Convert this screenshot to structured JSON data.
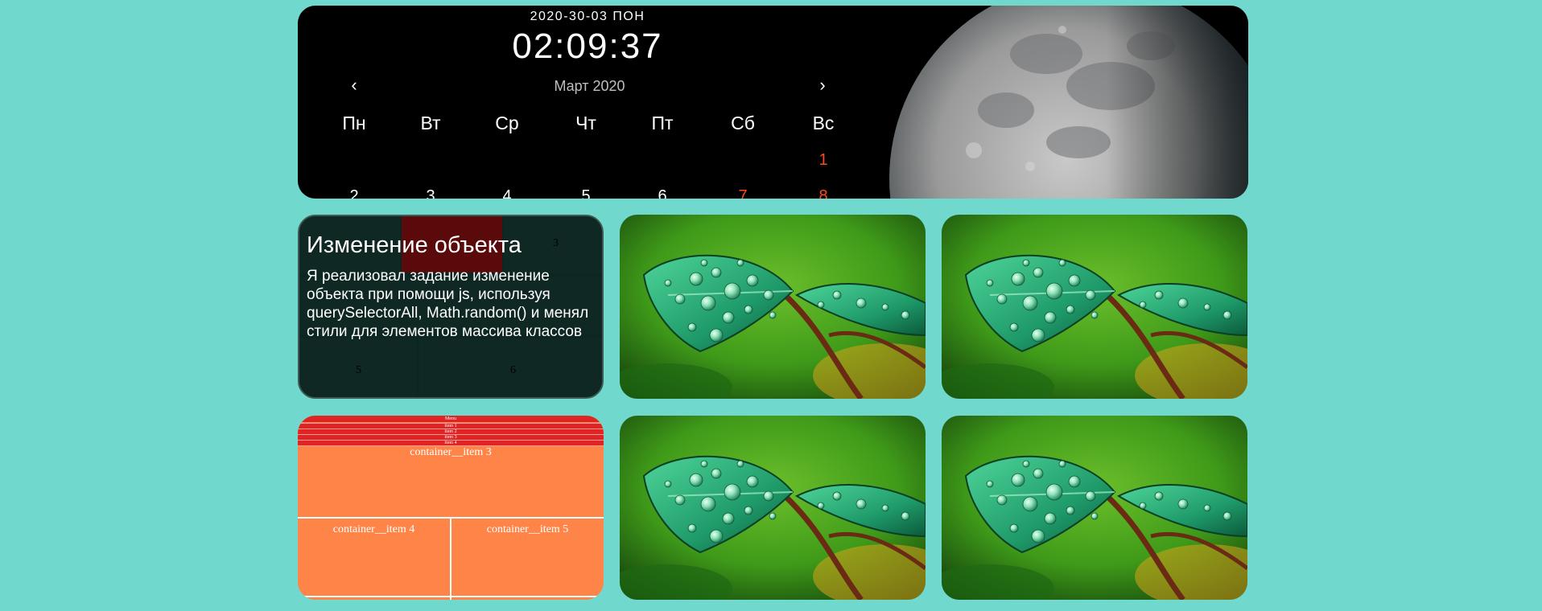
{
  "header": {
    "date": "2020-30-03 ПОН",
    "time": "02:09:37",
    "prev_label": "‹",
    "next_label": "›",
    "month": "Март 2020",
    "weekdays": [
      "Пн",
      "Вт",
      "Ср",
      "Чт",
      "Пт",
      "Сб",
      "Вс"
    ],
    "week1_days": [
      "1"
    ],
    "week2_days": [
      "2",
      "3",
      "4",
      "5",
      "6",
      "7",
      "8"
    ],
    "weekend_color": "#ff4a1c",
    "moon_image": "moon-photo"
  },
  "project_card": {
    "title": "Изменение объекта",
    "description": "Я реализовал задание изменение объекта при помощи js, используя querySelectorAll, Math.random() и менял стили для элементов массива классов",
    "grid_numbers": [
      "3",
      "5",
      "6"
    ],
    "accent_color": "#5a0a0a"
  },
  "layout_card": {
    "menu_label": "Menu",
    "menu_items": [
      "item 1",
      "item 2",
      "item 3",
      "item 4"
    ],
    "items": [
      "container__item 3",
      "container__item 4",
      "container__item 5"
    ],
    "menu_color": "#e02424",
    "body_color": "#ff8448"
  },
  "gallery": {
    "image": "leaf-water-drops-photo"
  },
  "page": {
    "background": "#71d8ce"
  }
}
